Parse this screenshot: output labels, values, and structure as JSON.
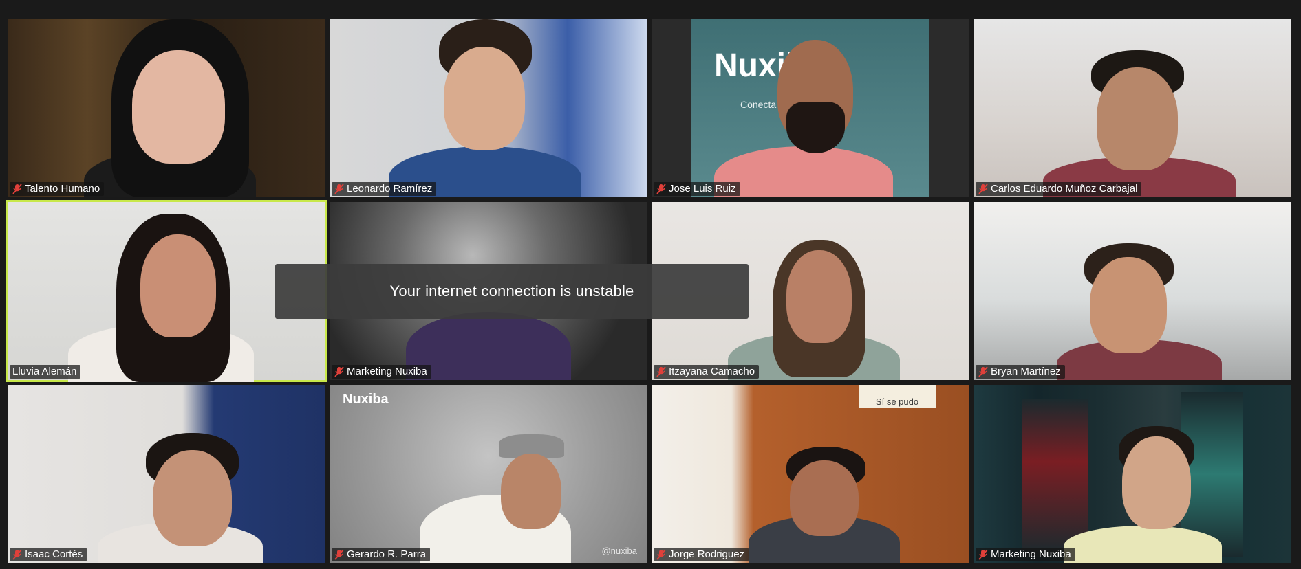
{
  "toast": {
    "message": "Your internet connection is unstable"
  },
  "colors": {
    "active_speaker_border": "#c8e84a",
    "mute_icon": "#e0403a",
    "background": "#1a1a1a"
  },
  "participants": [
    {
      "name": "Talento Humano",
      "muted": true,
      "mute_icon": "mic-muted-icon"
    },
    {
      "name": "Leonardo Ramírez",
      "muted": true,
      "mute_icon": "mic-muted-icon"
    },
    {
      "name": "Jose Luis Ruiz",
      "muted": true,
      "mute_icon": "mic-muted-icon"
    },
    {
      "name": "Carlos Eduardo Muñoz Carbajal",
      "muted": true,
      "mute_icon": "mic-muted-icon"
    },
    {
      "name": "Lluvia Alemán",
      "muted": false,
      "active_speaker": true
    },
    {
      "name": "Marketing Nuxiba",
      "muted": true,
      "mute_icon": "mic-muted-icon"
    },
    {
      "name": "Itzayana Camacho",
      "muted": true,
      "mute_icon": "mic-muted-icon"
    },
    {
      "name": "Bryan Martínez",
      "muted": true,
      "mute_icon": "mic-muted-icon"
    },
    {
      "name": "Isaac Cortés",
      "muted": true,
      "mute_icon": "mic-muted-icon"
    },
    {
      "name": "Gerardo R. Parra",
      "muted": true,
      "mute_icon": "mic-muted-icon"
    },
    {
      "name": "Jorge Rodriguez",
      "muted": true,
      "mute_icon": "mic-muted-icon"
    },
    {
      "name": "Marketing Nuxiba",
      "muted": true,
      "mute_icon": "mic-muted-icon"
    }
  ],
  "backgrounds": {
    "nuxiba_logo_text": "Nuxiba",
    "nuxiba_watermark": "@nuxiba",
    "jose_banner_text": "Conecta",
    "sign_text": "Sí se pudo"
  }
}
